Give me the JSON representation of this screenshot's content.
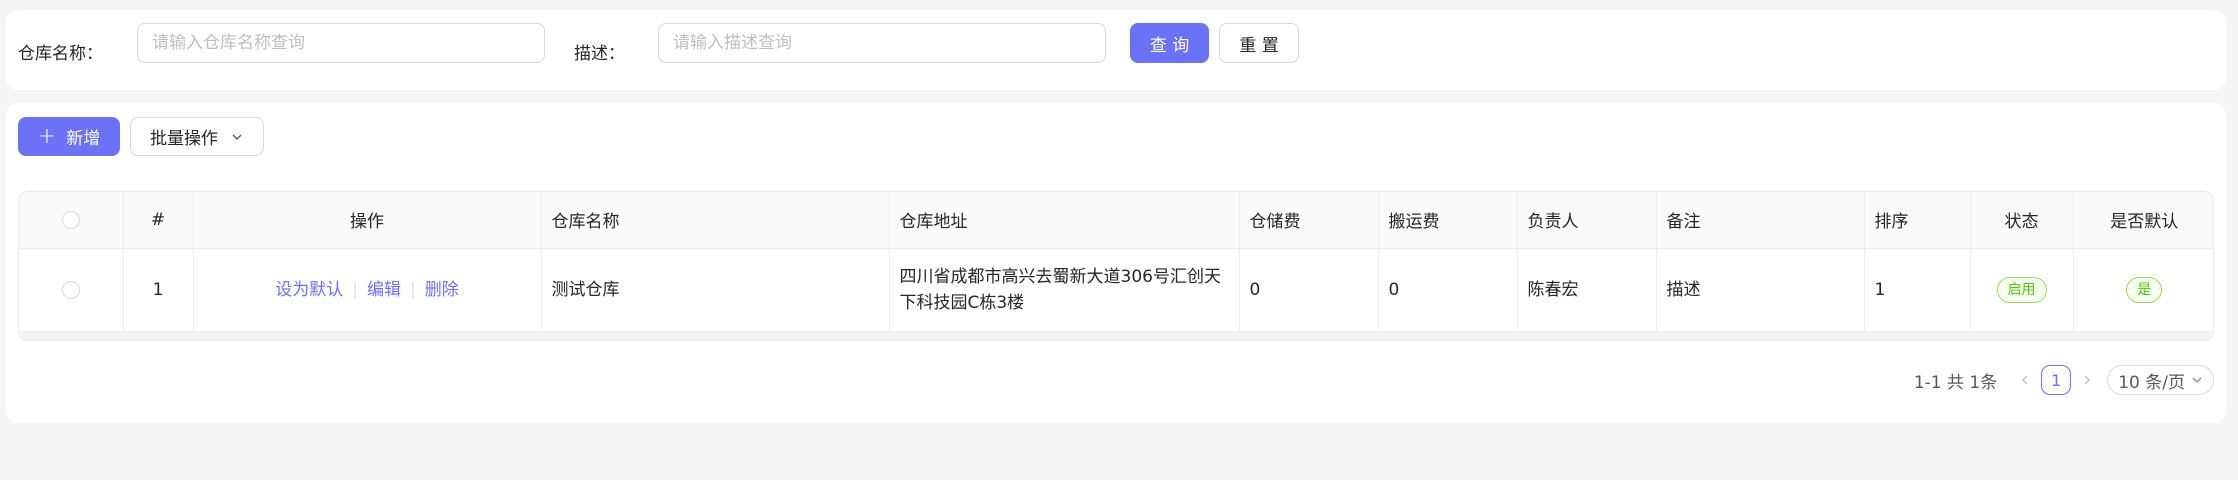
{
  "search": {
    "name_label": "仓库名称：",
    "name_placeholder": "请输入仓库名称查询",
    "name_value": "",
    "desc_label": "描述：",
    "desc_placeholder": "请输入描述查询",
    "desc_value": "",
    "query_label": "查 询",
    "reset_label": "重 置"
  },
  "toolbar": {
    "add_label": "新增",
    "batch_label": "批量操作"
  },
  "table": {
    "columns": [
      "#",
      "操作",
      "仓库名称",
      "仓库地址",
      "仓储费",
      "搬运费",
      "负责人",
      "备注",
      "排序",
      "状态",
      "是否默认"
    ],
    "rows": [
      {
        "index": "1",
        "actions": [
          "设为默认",
          "编辑",
          "删除"
        ],
        "name": "测试仓库",
        "address": "四川省成都市高兴去蜀新大道306号汇创天下科技园C栋3楼",
        "storage_fee": "0",
        "handling_fee": "0",
        "manager": "陈春宏",
        "remark": "描述",
        "sort": "1",
        "status": "启用",
        "is_default": "是"
      }
    ]
  },
  "pagination": {
    "total_text": "1-1 共 1条",
    "current_page": "1",
    "page_size": "10 条/页"
  },
  "colors": {
    "primary": "#6b72f6",
    "tag_green": "#52c41a"
  }
}
